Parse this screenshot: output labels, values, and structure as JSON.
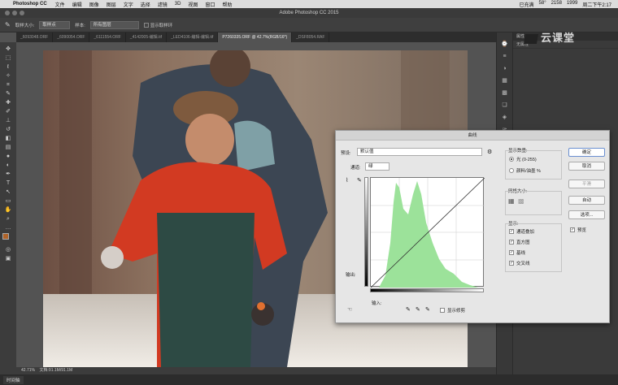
{
  "menubar": {
    "app": "Photoshop CC",
    "items": [
      "文件",
      "编辑",
      "图像",
      "图层",
      "文字",
      "选择",
      "滤镜",
      "3D",
      "视图",
      "窗口",
      "帮助"
    ],
    "right": [
      "已充满",
      "58°",
      "2158",
      "1999",
      "周二下午2:17"
    ]
  },
  "titlebar": {
    "title": "Adobe Photoshop CC 2015"
  },
  "options": {
    "size_label": "取样大小:",
    "size_value": "取样点",
    "sample_label": "样本:",
    "sample_value": "所有图层",
    "show_ring": "显示取样环"
  },
  "tabs": [
    "_6093048.ORF",
    "_6090054.ORF",
    "_6111554.ORF",
    "_4142005-编辑.tif",
    "_LED4106-编辑-编辑.tif",
    "P7260335.ORF @ 42.7%(RGB/16*)",
    "_DSF8054.RAF"
  ],
  "status": {
    "zoom": "42.71%",
    "doc": "文档:91.1M/91.1M"
  },
  "bottom": {
    "timeline": "时间轴"
  },
  "panel": {
    "tab1": "属性",
    "row1": "无属性"
  },
  "watermark": "云课堂",
  "dialog": {
    "title": "曲线",
    "preset_label": "预设:",
    "preset_value": "默认值",
    "channel_label": "通道:",
    "channel_value": "绿",
    "output_label": "输出:",
    "input_label": "输入:",
    "show_clipping": "显示修剪",
    "display_amount": "显示数量:",
    "light": "光 (0-255)",
    "pigment": "颜料/油墨 %",
    "grid_size": "网格大小:",
    "show": "显示:",
    "overlay": "通道叠加",
    "histogram": "直方图",
    "baseline": "基线",
    "intersection": "交叉线",
    "buttons": {
      "ok": "确定",
      "cancel": "取消",
      "smooth": "平滑",
      "auto": "自动",
      "options": "选项..."
    },
    "preview": "预览"
  }
}
